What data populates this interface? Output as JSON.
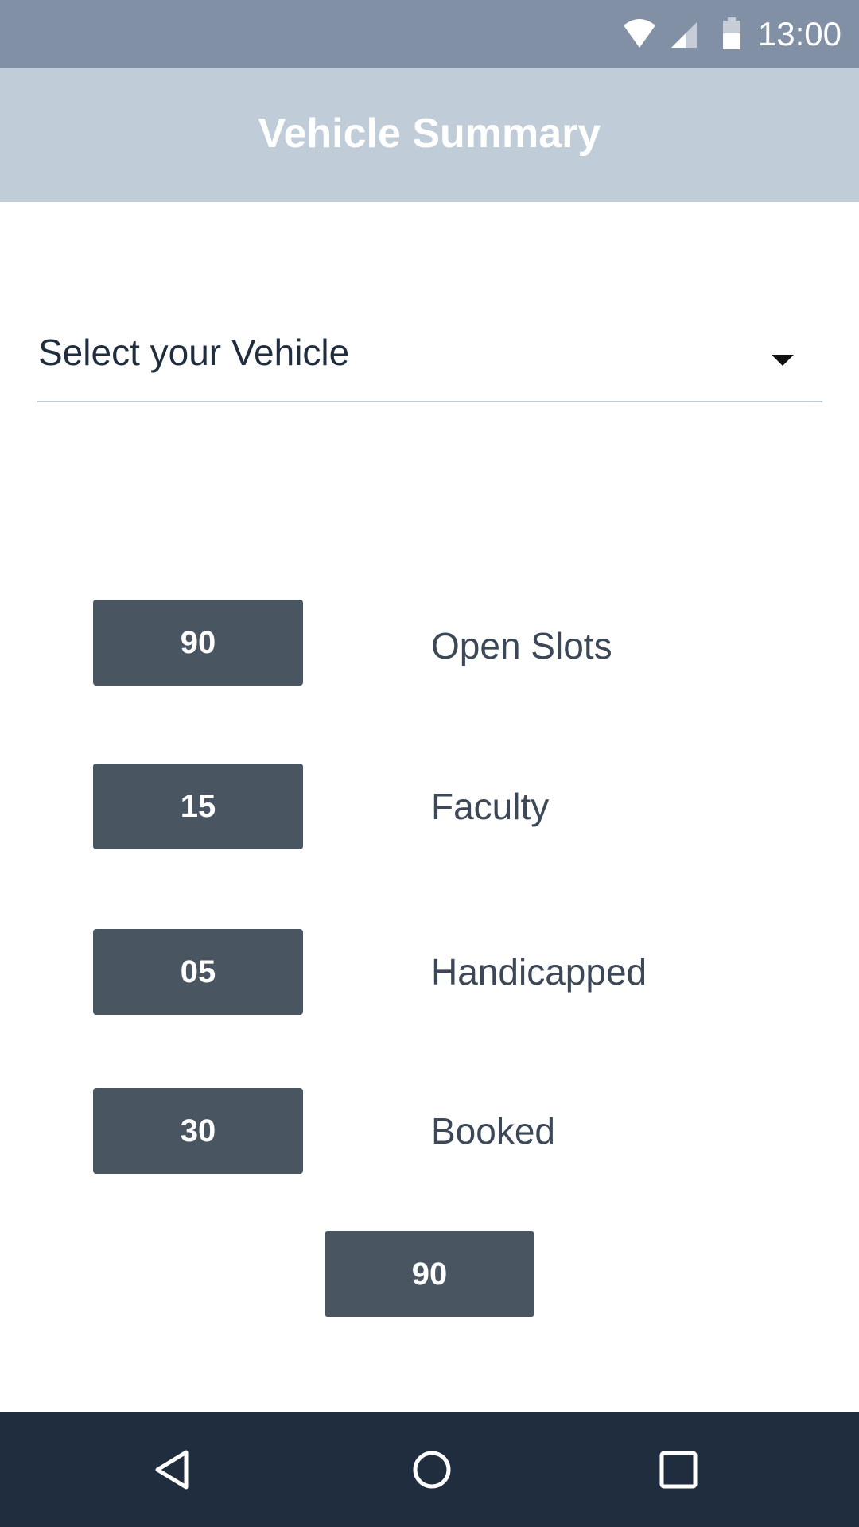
{
  "status_bar": {
    "time": "13:00",
    "icons": [
      "wifi-icon",
      "signal-icon",
      "battery-icon"
    ],
    "background": "#8190a5"
  },
  "app_bar": {
    "title": "Vehicle Summary",
    "background": "#c1ccd9"
  },
  "vehicle_select": {
    "placeholder": "Select your Vehicle",
    "icon": "caret-down-icon"
  },
  "stats": [
    {
      "value": "90",
      "label": "Open Slots"
    },
    {
      "value": "15",
      "label": "Faculty"
    },
    {
      "value": "05",
      "label": "Handicapped"
    },
    {
      "value": "30",
      "label": "Booked"
    }
  ],
  "total": {
    "value": "90"
  },
  "colors": {
    "stat_box": "#4a5562",
    "nav_bar": "#1f2d3e"
  },
  "nav_bar": {
    "buttons": [
      "back-icon",
      "home-icon",
      "recents-icon"
    ]
  }
}
